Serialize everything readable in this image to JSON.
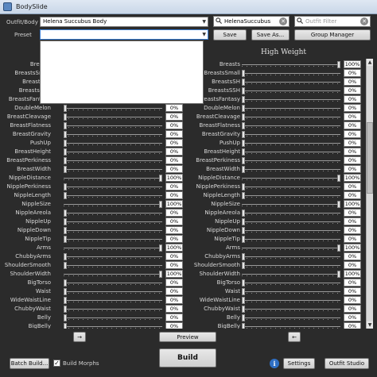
{
  "window": {
    "title": "BodySlide"
  },
  "outfit": {
    "label": "Outfit/Body",
    "value": "Helena Succubus Body"
  },
  "preset": {
    "label": "Preset",
    "value": ""
  },
  "outfit_search": {
    "value": "HelenaSuccubus"
  },
  "outfit_filter": {
    "placeholder": "Outfit Filter"
  },
  "buttons": {
    "save": "Save",
    "save_as": "Save As...",
    "group_manager": "Group Manager",
    "preview": "Preview",
    "build": "Build",
    "batch_build": "Batch Build...",
    "settings": "Settings",
    "outfit_studio": "Outfit Studio",
    "left_arrow": "→",
    "right_arrow": "←"
  },
  "build_morphs": {
    "label": "Build Morphs",
    "checked": true
  },
  "headings": {
    "high_weight": "High Weight"
  },
  "sliders": [
    {
      "name": "Breasts",
      "low_pct": "",
      "high": "100%",
      "high_v": 1.0
    },
    {
      "name": "BreastsSmall",
      "low_pct": "",
      "high": "0%",
      "high_v": 0
    },
    {
      "name": "BreastsSH",
      "low_pct": "",
      "high": "0%",
      "high_v": 0
    },
    {
      "name": "BreastsSSH",
      "low_pct": "",
      "high": "0%",
      "high_v": 0
    },
    {
      "name": "BreastsFantasy",
      "low_pct": "",
      "high": "0%",
      "high_v": 0
    },
    {
      "name": "DoubleMelon",
      "low_pct": "0%",
      "low_v": 0,
      "high": "0%",
      "high_v": 0
    },
    {
      "name": "BreastCleavage",
      "low_pct": "0%",
      "low_v": 0,
      "high": "0%",
      "high_v": 0
    },
    {
      "name": "BreastFlatness",
      "low_pct": "0%",
      "low_v": 0,
      "high": "0%",
      "high_v": 0
    },
    {
      "name": "BreastGravity",
      "low_pct": "0%",
      "low_v": 0,
      "high": "0%",
      "high_v": 0
    },
    {
      "name": "PushUp",
      "low_pct": "0%",
      "low_v": 0,
      "high": "0%",
      "high_v": 0
    },
    {
      "name": "BreastHeight",
      "low_pct": "0%",
      "low_v": 0,
      "high": "0%",
      "high_v": 0
    },
    {
      "name": "BreastPerkiness",
      "low_pct": "0%",
      "low_v": 0,
      "high": "0%",
      "high_v": 0
    },
    {
      "name": "BreastWidth",
      "low_pct": "0%",
      "low_v": 0,
      "high": "0%",
      "high_v": 0
    },
    {
      "name": "NippleDistance",
      "low_pct": "100%",
      "low_v": 1.0,
      "high": "100%",
      "high_v": 1.0
    },
    {
      "name": "NipplePerkiness",
      "low_pct": "0%",
      "low_v": 0,
      "high": "0%",
      "high_v": 0
    },
    {
      "name": "NippleLength",
      "low_pct": "0%",
      "low_v": 0,
      "high": "0%",
      "high_v": 0
    },
    {
      "name": "NippleSize",
      "low_pct": "100%",
      "low_v": 1.0,
      "high": "100%",
      "high_v": 1.0
    },
    {
      "name": "NippleAreola",
      "low_pct": "0%",
      "low_v": 0,
      "high": "0%",
      "high_v": 0
    },
    {
      "name": "NippleUp",
      "low_pct": "0%",
      "low_v": 0,
      "high": "0%",
      "high_v": 0
    },
    {
      "name": "NippleDown",
      "low_pct": "0%",
      "low_v": 0,
      "high": "0%",
      "high_v": 0
    },
    {
      "name": "NippleTip",
      "low_pct": "0%",
      "low_v": 0,
      "high": "0%",
      "high_v": 0
    },
    {
      "name": "Arms",
      "low_pct": "100%",
      "low_v": 1.0,
      "high": "100%",
      "high_v": 1.0
    },
    {
      "name": "ChubbyArms",
      "low_pct": "0%",
      "low_v": 0,
      "high": "0%",
      "high_v": 0
    },
    {
      "name": "ShoulderSmooth",
      "low_pct": "0%",
      "low_v": 0,
      "high": "0%",
      "high_v": 0
    },
    {
      "name": "ShoulderWidth",
      "low_pct": "100%",
      "low_v": 1.0,
      "high": "100%",
      "high_v": 1.0
    },
    {
      "name": "BigTorso",
      "low_pct": "0%",
      "low_v": 0,
      "high": "0%",
      "high_v": 0
    },
    {
      "name": "Waist",
      "low_pct": "0%",
      "low_v": 0,
      "high": "0%",
      "high_v": 0
    },
    {
      "name": "WideWaistLine",
      "low_pct": "0%",
      "low_v": 0,
      "high": "0%",
      "high_v": 0
    },
    {
      "name": "ChubbyWaist",
      "low_pct": "0%",
      "low_v": 0,
      "high": "0%",
      "high_v": 0
    },
    {
      "name": "Belly",
      "low_pct": "0%",
      "low_v": 0,
      "high": "0%",
      "high_v": 0
    },
    {
      "name": "BigBelly",
      "low_pct": "0%",
      "low_v": 0,
      "high": "0%",
      "high_v": 0
    }
  ]
}
